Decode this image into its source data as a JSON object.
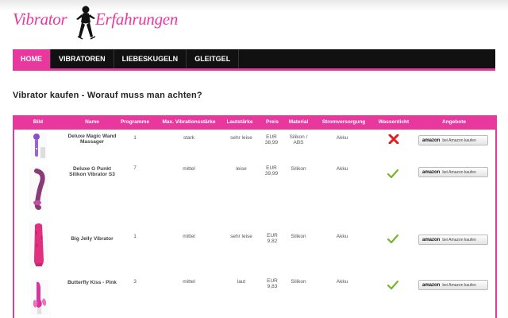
{
  "logo": {
    "word1": "Vibrator",
    "word2": "Erfahrungen"
  },
  "nav": {
    "items": [
      {
        "label": "HOME",
        "active": true
      },
      {
        "label": "VIBRATOREN",
        "active": false
      },
      {
        "label": "LIEBESKUGELN",
        "active": false
      },
      {
        "label": "GLEITGEL",
        "active": false
      }
    ]
  },
  "heading": "Vibrator kaufen - Worauf muss man achten?",
  "colors": {
    "accent": "#e8389d",
    "nav_bg": "#111111",
    "check": "#7ab32e",
    "cross": "#e02020"
  },
  "table": {
    "headers": [
      "Bild",
      "Name",
      "Programme",
      "Max. Vibrationsstärke",
      "Lautstärke",
      "Preis",
      "Material",
      "Stromversorgung",
      "Wasserdicht",
      "Angebote"
    ],
    "button": {
      "brand": "amazon",
      "text": "bei Amazon kaufen"
    },
    "rows": [
      {
        "name": "Deluxe Magic Wand Massager",
        "programme": "1",
        "vibration": "stark",
        "lautstaerke": "sehr leise",
        "preis": "EUR 38,99",
        "material": "Silikon / ABS",
        "strom": "Akku",
        "wasserdicht": false,
        "image_icon": "wand-vibrator-icon"
      },
      {
        "name": "Deluxe G Punkt Silikon Vibrator S3",
        "programme": "7",
        "vibration": "mittel",
        "lautstaerke": "leise",
        "preis": "EUR 39,99",
        "material": "Silikon",
        "strom": "Akku",
        "wasserdicht": true,
        "image_icon": "g-spot-vibrator-icon"
      },
      {
        "name": "Big Jelly Vibrator",
        "programme": "1",
        "vibration": "mittel",
        "lautstaerke": "sehr leise",
        "preis": "EUR 9,82",
        "material": "Silikon",
        "strom": "Akku",
        "wasserdicht": true,
        "image_icon": "jelly-vibrator-icon"
      },
      {
        "name": "Butterfly Kiss - Pink",
        "programme": "3",
        "vibration": "mittel",
        "lautstaerke": "laut",
        "preis": "EUR 9,83",
        "material": "Silikon",
        "strom": "Akku",
        "wasserdicht": true,
        "image_icon": "butterfly-vibrator-icon"
      }
    ]
  }
}
